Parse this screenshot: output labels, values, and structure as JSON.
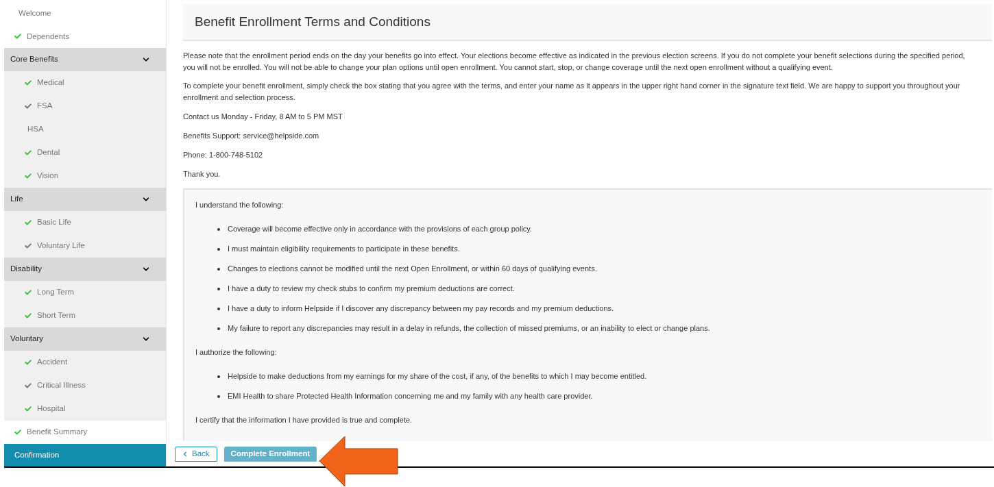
{
  "sidebar": {
    "items": [
      {
        "kind": "link",
        "label": "Welcome",
        "checked": false,
        "selected": false
      },
      {
        "kind": "link",
        "label": "Dependents",
        "checked": true,
        "color": "#3cc13c",
        "selected": false
      },
      {
        "kind": "group",
        "label": "Core Benefits",
        "expanded": true,
        "children": [
          {
            "label": "Medical",
            "checked": true,
            "color": "#3cc13c",
            "selected": false
          },
          {
            "label": "FSA",
            "checked": true,
            "color": "#777777",
            "selected": false
          },
          {
            "label": "HSA",
            "checked": false,
            "selected": false
          },
          {
            "label": "Dental",
            "checked": true,
            "color": "#3cc13c",
            "selected": false
          },
          {
            "label": "Vision",
            "checked": true,
            "color": "#3cc13c",
            "selected": false
          }
        ]
      },
      {
        "kind": "group",
        "label": "Life",
        "expanded": true,
        "children": [
          {
            "label": "Basic Life",
            "checked": true,
            "color": "#3cc13c",
            "selected": false
          },
          {
            "label": "Voluntary Life",
            "checked": true,
            "color": "#777777",
            "selected": false
          }
        ]
      },
      {
        "kind": "group",
        "label": "Disability",
        "expanded": true,
        "children": [
          {
            "label": "Long Term",
            "checked": true,
            "color": "#3cc13c",
            "selected": false
          },
          {
            "label": "Short Term",
            "checked": true,
            "color": "#3cc13c",
            "selected": false
          }
        ]
      },
      {
        "kind": "group",
        "label": "Voluntary",
        "expanded": true,
        "children": [
          {
            "label": "Accident",
            "checked": true,
            "color": "#3cc13c",
            "selected": false
          },
          {
            "label": "Critical Illness",
            "checked": true,
            "color": "#777777",
            "selected": false
          },
          {
            "label": "Hospital",
            "checked": true,
            "color": "#3cc13c",
            "selected": false
          }
        ]
      },
      {
        "kind": "link",
        "label": "Benefit Summary",
        "checked": true,
        "color": "#3cc13c",
        "selected": false
      },
      {
        "kind": "link",
        "label": "Confirmation",
        "checked": false,
        "selected": true
      }
    ]
  },
  "title": "Benefit Enrollment Terms and Conditions",
  "paragraphs": [
    "Please note that the enrollment period ends on the day your benefits go into effect. Your elections become effective as indicated in the previous election screens. If you do not complete your benefit selections during the specified period, you will not be enrolled. You will not be able to change your plan options until open enrollment. You cannot start, stop, or change coverage until the next open enrollment without a qualifying event.",
    "To complete your benefit enrollment, simply check the box stating that you agree with the terms, and enter your name as it appears in the upper right hand corner in the signature text field. We are happy to support you throughout your enrollment and selection process.",
    "Contact us Monday - Friday, 8 AM to 5 PM MST",
    "Benefits Support: service@helpside.com",
    "Phone: 1-800-748-5102",
    "Thank you."
  ],
  "terms": [
    {
      "kind": "heading",
      "text": "I understand the following:"
    },
    {
      "kind": "list",
      "items": [
        "Coverage will become effective only in accordance with the provisions of each group policy.",
        "I must maintain eligibility requirements to participate in these benefits.",
        "Changes to elections cannot be modified until the next Open Enrollment, or within 60 days of qualifying events.",
        "I have a duty to review my check stubs to confirm my premium deductions are correct.",
        "I have a duty to inform Helpside if I discover any discrepancy between my pay records and my premium deductions.",
        "My failure to report any discrepancies may result in a delay in refunds, the collection of missed premiums, or an inability to elect or change plans."
      ]
    },
    {
      "kind": "heading",
      "text": "I authorize the following:"
    },
    {
      "kind": "list",
      "items": [
        "Helpside to make deductions from my earnings for my share of the cost, if any, of the benefits to which I may become entitled.",
        "EMI Health to share Protected Health Information concerning me and my family with any health care provider."
      ]
    },
    {
      "kind": "heading",
      "text": "I certify that the information I have provided is true and complete."
    }
  ],
  "buttons": [
    {
      "kind": "back",
      "label": "Back"
    },
    {
      "kind": "primary",
      "label": "Complete Enrollment"
    }
  ]
}
